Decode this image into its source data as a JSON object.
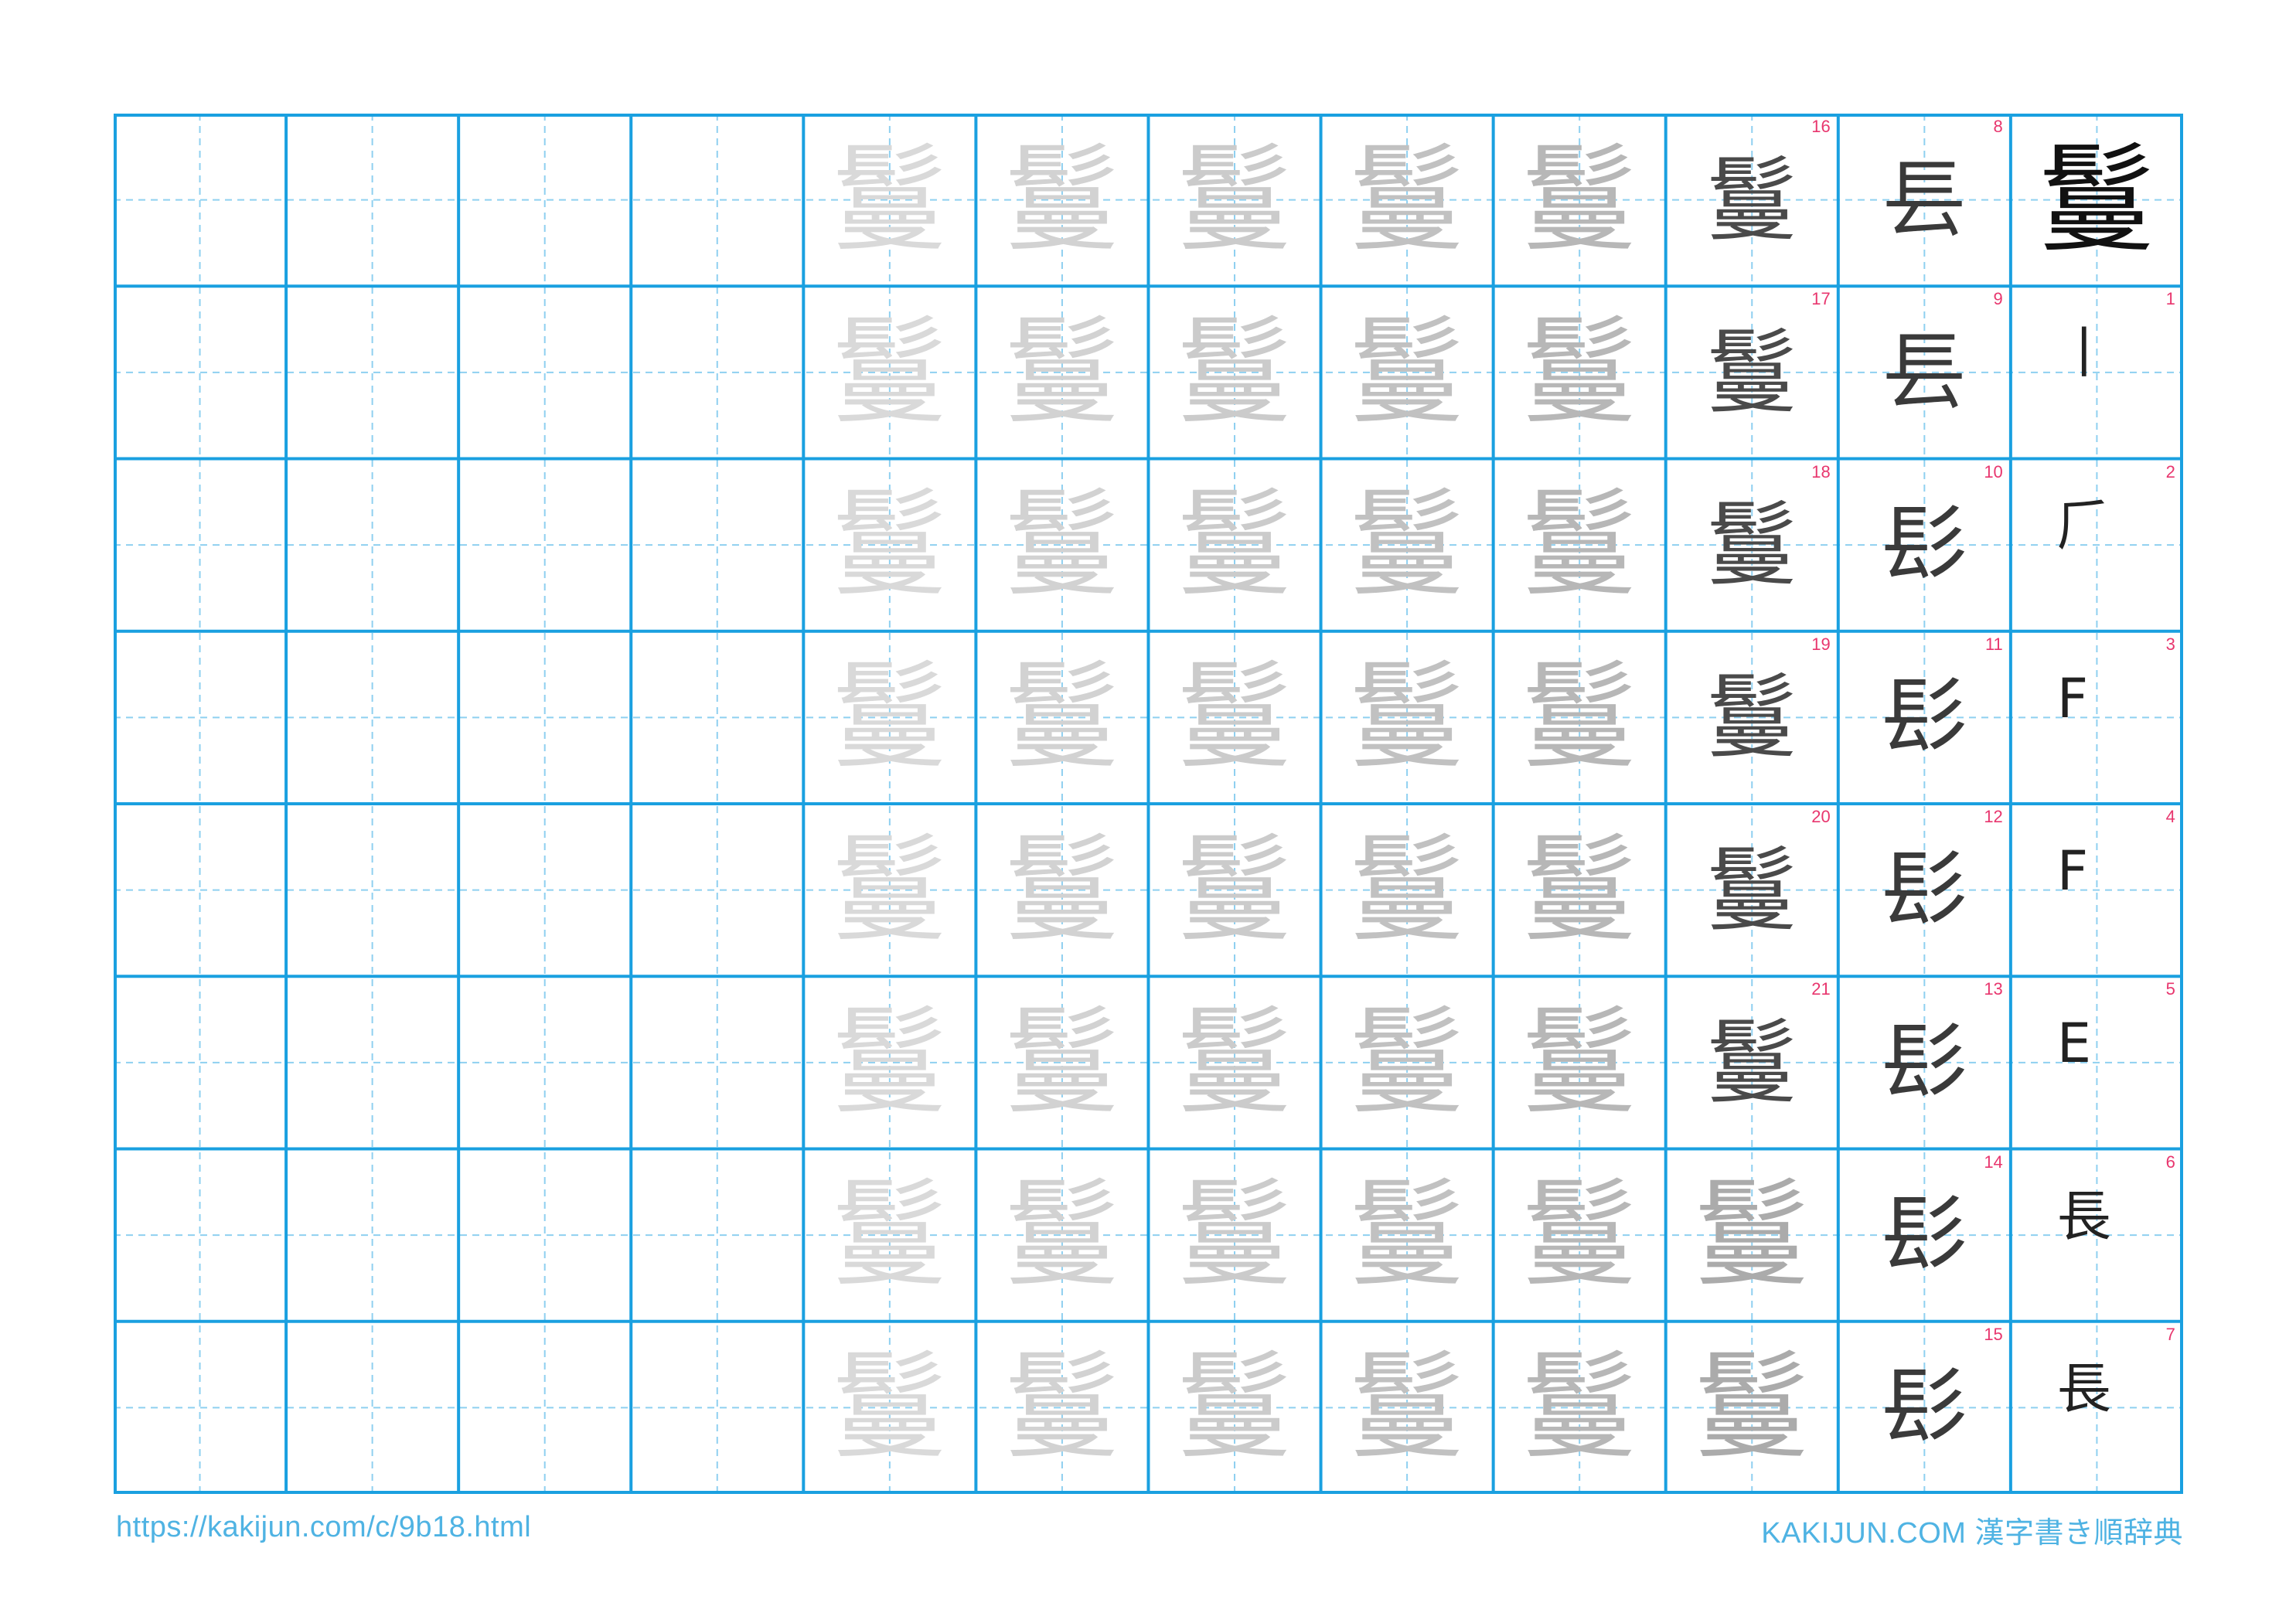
{
  "colors": {
    "grid": "#1aa0e0",
    "guide": "#8fd0f0",
    "stroke_number": "#e8366e",
    "footer": "#4fb3e3",
    "trace_shades": [
      "#d9d9d9",
      "#d2d2d2",
      "#cbcbcb",
      "#c1c1c1",
      "#b7b7b7",
      "#ababab"
    ]
  },
  "worksheet": {
    "kanji": "鬘",
    "total_strokes": 21,
    "model_character": "鬘",
    "stroke_order": [
      {
        "num": "1",
        "text": "丨"
      },
      {
        "num": "2",
        "text": "𠂆"
      },
      {
        "num": "3",
        "text": "F"
      },
      {
        "num": "4",
        "text": "F"
      },
      {
        "num": "5",
        "text": "E"
      },
      {
        "num": "6",
        "text": "長"
      },
      {
        "num": "7",
        "text": "長"
      },
      {
        "num": "8",
        "text": "镸"
      },
      {
        "num": "9",
        "text": "镸"
      },
      {
        "num": "10",
        "text": "髟"
      },
      {
        "num": "11",
        "text": "髟"
      },
      {
        "num": "12",
        "text": "髟"
      },
      {
        "num": "13",
        "text": "髟"
      },
      {
        "num": "14",
        "text": "髟"
      },
      {
        "num": "15",
        "text": "髟"
      },
      {
        "num": "16",
        "text": "鬘"
      },
      {
        "num": "17",
        "text": "鬘"
      },
      {
        "num": "18",
        "text": "鬘"
      },
      {
        "num": "19",
        "text": "鬘"
      },
      {
        "num": "20",
        "text": "鬘"
      },
      {
        "num": "21",
        "text": "鬘"
      }
    ],
    "trace_character": "鬘"
  },
  "footer": {
    "url": "https://kakijun.com/c/9b18.html",
    "brand": "KAKIJUN.COM 漢字書き順辞典"
  }
}
